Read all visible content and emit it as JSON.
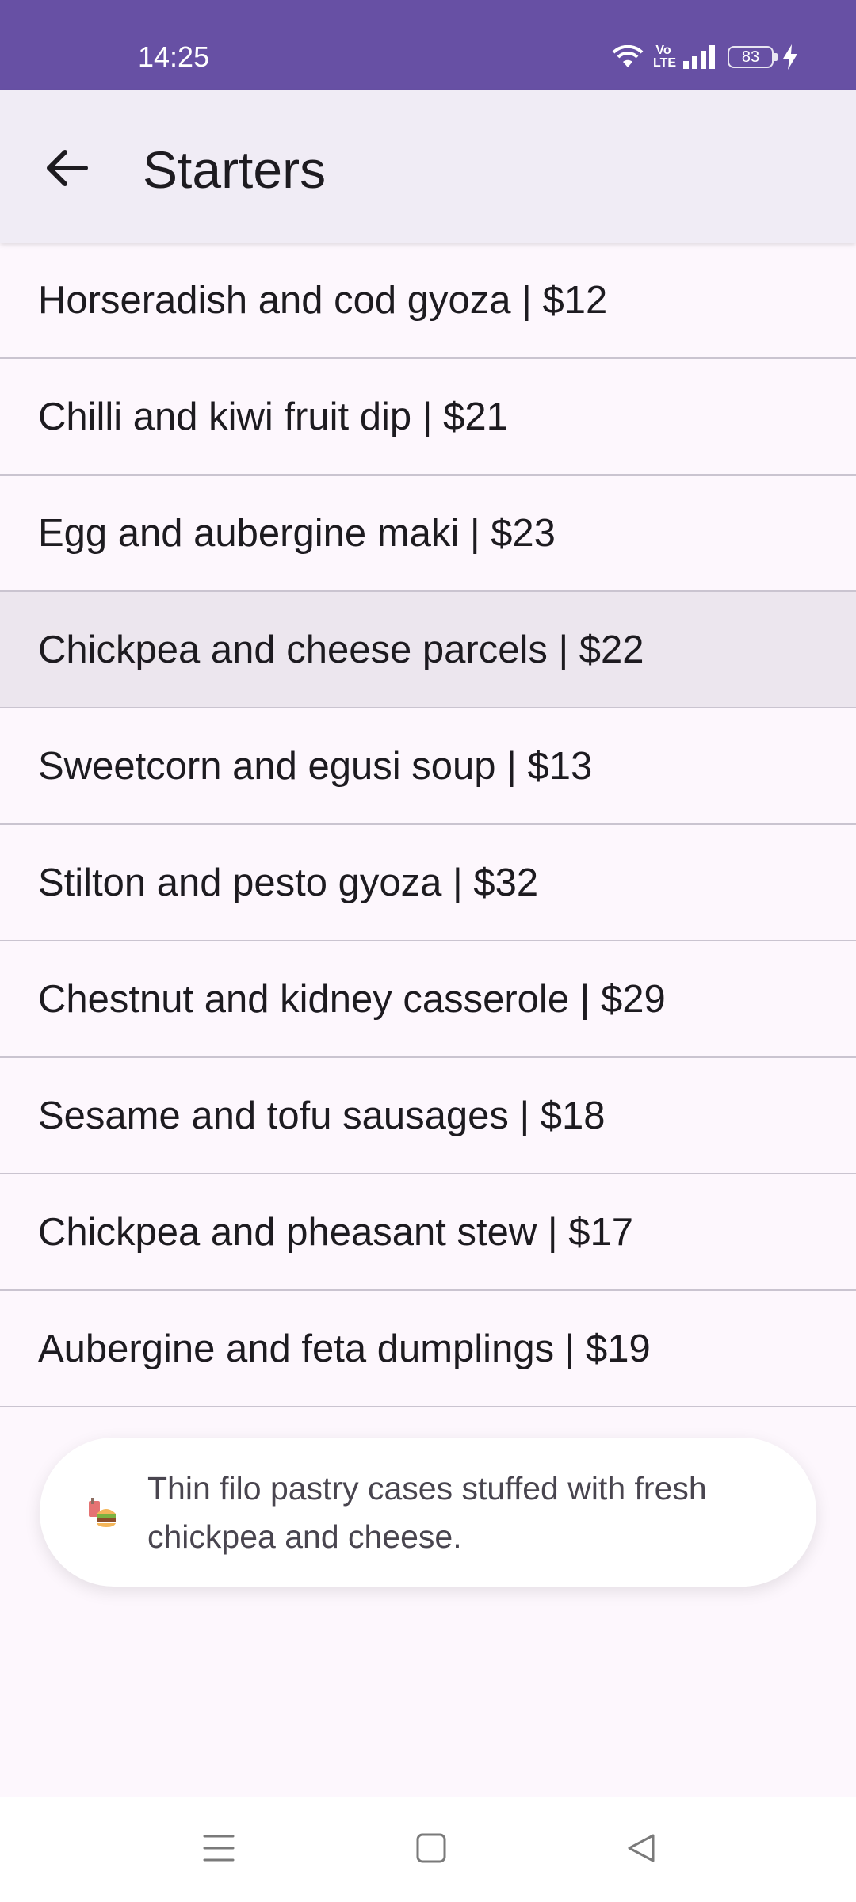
{
  "status_bar": {
    "time": "14:25",
    "volte_label": "Vo LTE",
    "battery_level": "83",
    "icons": [
      "wifi-icon",
      "volte-icon",
      "signal-icon",
      "battery-icon",
      "charging-icon"
    ]
  },
  "app_bar": {
    "title": "Starters",
    "back_icon": "arrow-back-icon"
  },
  "menu": {
    "items": [
      {
        "label": "Horseradish and cod gyoza | $12"
      },
      {
        "label": "Chilli and kiwi fruit dip | $21"
      },
      {
        "label": "Egg and aubergine maki | $23"
      },
      {
        "label": "Chickpea and cheese parcels | $22"
      },
      {
        "label": "Sweetcorn and egusi soup | $13"
      },
      {
        "label": "Stilton and pesto gyoza | $32"
      },
      {
        "label": "Chestnut and kidney casserole | $29"
      },
      {
        "label": "Sesame and tofu sausages | $18"
      },
      {
        "label": "Chickpea and pheasant stew | $17"
      },
      {
        "label": "Aubergine and feta dumplings | $19"
      }
    ],
    "selected_index": 3
  },
  "snackbar": {
    "icon": "food-icon",
    "text": "Thin filo pastry cases stuffed with fresh chickpea and cheese."
  },
  "nav_bar": {
    "icons": [
      "menu-icon",
      "home-icon",
      "back-triangle-icon"
    ]
  },
  "colors": {
    "status_bar": "#6750a4",
    "app_bar": "#f0ecf5",
    "background": "#fdf7fd",
    "selected_row": "#ece6ee",
    "divider": "#cac4d0"
  }
}
